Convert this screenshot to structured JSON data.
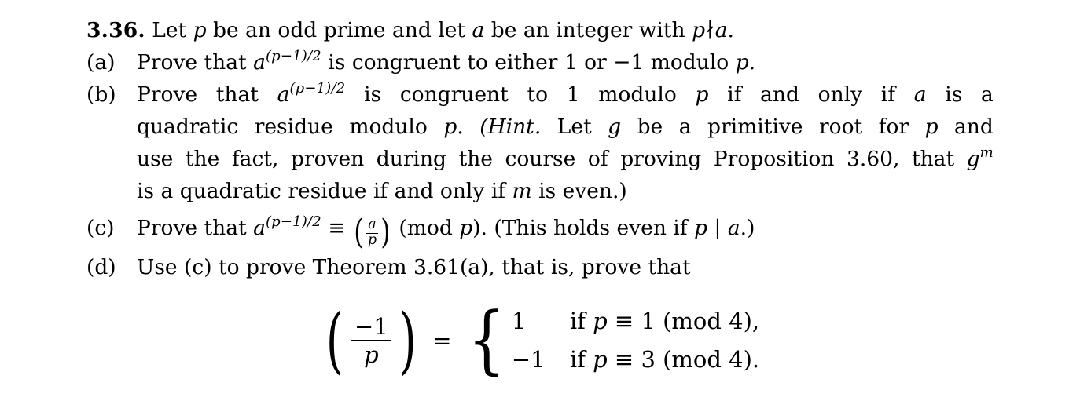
{
  "exercise": {
    "number": "3.36.",
    "intro": {
      "before_p": "Let",
      "var_p": "p",
      "middle": "be an odd prime and let",
      "var_a": "a",
      "after_a": "be an integer with",
      "condition_p": "p",
      "condition_op": "∤",
      "condition_a": "a",
      "period": "."
    },
    "items": [
      {
        "tag": "(a)",
        "text_1": "Prove that",
        "base_a": "a",
        "exponent": "(p−1)/2",
        "text_2": "is congruent to either 1 or −1 modulo",
        "var_p": "p",
        "period": "."
      },
      {
        "tag": "(b)",
        "line_1_chunks": [
          "Prove",
          "that",
          "a",
          "(p−1)/2",
          "is",
          "congruent",
          "to",
          "1",
          "modulo",
          "p",
          "if",
          "and",
          "only",
          "if",
          "a",
          "is",
          "a"
        ],
        "line_2_chunks": [
          "quadratic",
          "residue",
          "modulo",
          "p.",
          "(Hint.",
          "Let",
          "g",
          "be",
          "a",
          "primitive",
          "root",
          "for",
          "p",
          "and"
        ],
        "line_3_chunks": [
          "use",
          "the",
          "fact,",
          "proven",
          "during",
          "the",
          "course",
          "of",
          "proving",
          "Proposition",
          "3.60,",
          "that",
          "g",
          "m"
        ],
        "line_4_text_1": "is a quadratic residue if and only if",
        "line_4_var_m": "m",
        "line_4_text_2": "is even.)"
      },
      {
        "tag": "(c)",
        "text_1": "Prove that",
        "base_a": "a",
        "exponent": "(p−1)/2",
        "congruent_sign": "≡",
        "legendre_num": "a",
        "legendre_den": "p",
        "mod_text": "(mod",
        "mod_var": "p",
        "mod_close": ").",
        "text_2": "(This holds even if",
        "divides_p": "p",
        "divides_op": "|",
        "divides_a": "a",
        "text_3": ".)"
      },
      {
        "tag": "(d)",
        "text": "Use (c) to prove Theorem 3.61(a), that is, prove that"
      }
    ],
    "display_equation": {
      "legendre_num": "−1",
      "legendre_den": "p",
      "equals": "=",
      "brace": "{",
      "cases": [
        {
          "value": "1",
          "condition_if": "if",
          "condition_var": "p",
          "condition_op": "≡",
          "condition_val": "1",
          "modulus": "(mod 4),"
        },
        {
          "value": "−1",
          "condition_if": "if",
          "condition_var": "p",
          "condition_op": "≡",
          "condition_val": "3",
          "modulus": "(mod 4)."
        }
      ]
    }
  }
}
